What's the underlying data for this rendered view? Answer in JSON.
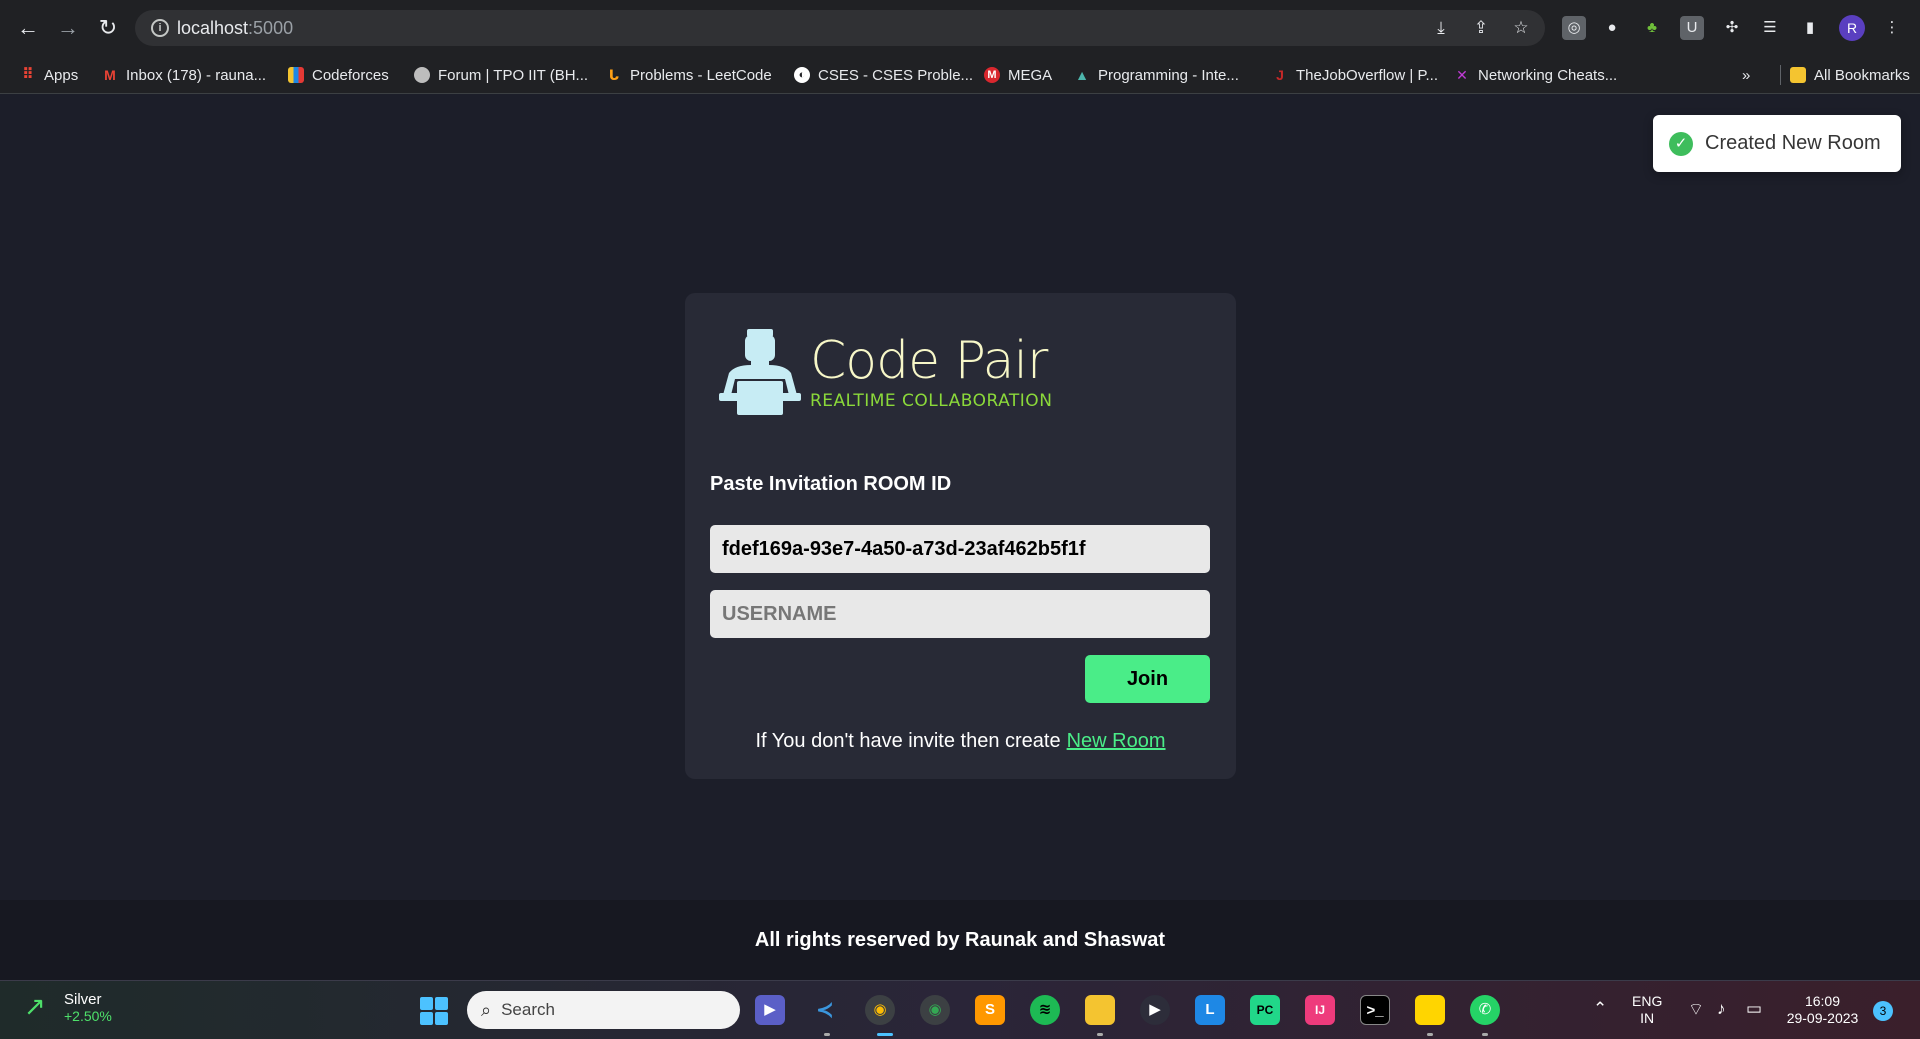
{
  "browser": {
    "url_host": "localhost",
    "url_port": ":5000",
    "profile_initial": "R"
  },
  "bookmarks": [
    {
      "label": "Apps",
      "icon": "apps-grid-icon",
      "color": "#ea4335"
    },
    {
      "label": "Inbox (178) - rauna...",
      "icon": "gmail-icon",
      "color": "#ea4335"
    },
    {
      "label": "Codeforces",
      "icon": "codeforces-icon",
      "color": "#1e88e5"
    },
    {
      "label": "Forum | TPO IIT (BH...",
      "icon": "tpo-icon",
      "color": "#bdbdbd"
    },
    {
      "label": "Problems - LeetCode",
      "icon": "leetcode-icon",
      "color": "#ffa116"
    },
    {
      "label": "CSES - CSES Proble...",
      "icon": "cses-icon",
      "color": "#ffffff"
    },
    {
      "label": "MEGA",
      "icon": "mega-icon",
      "color": "#d9272e"
    },
    {
      "label": "Programming - Inte...",
      "icon": "mountain-icon",
      "color": "#4db6ac"
    },
    {
      "label": "TheJobOverflow | P...",
      "icon": "jobOverflow-icon",
      "color": "#c62828"
    },
    {
      "label": "Networking Cheats...",
      "icon": "network-icon",
      "color": "#c13bd6"
    },
    {
      "label": "All Bookmarks",
      "icon": "folder-icon",
      "color": "#f4c430"
    }
  ],
  "bookmarks_overflow": "»",
  "toast": {
    "message": "Created New Room"
  },
  "app": {
    "brand_name": "Code Pair",
    "brand_tagline": "REALTIME COLLABORATION",
    "room_label": "Paste Invitation ROOM ID",
    "room_id_value": "fdef169a-93e7-4a50-a73d-23af462b5f1f",
    "username_placeholder": "USERNAME",
    "join_label": "Join",
    "invite_text": "If You don't have invite then create",
    "new_room_link": "New Room",
    "footer": "All rights reserved by  Raunak and Shaswat",
    "accent_color": "#4aed88"
  },
  "taskbar": {
    "widget_title": "Silver",
    "widget_value": "+2.50%",
    "search_label": "Search",
    "lang_line1": "ENG",
    "lang_line2": "IN",
    "time": "16:09",
    "date": "29-09-2023",
    "notification_count": "3"
  }
}
